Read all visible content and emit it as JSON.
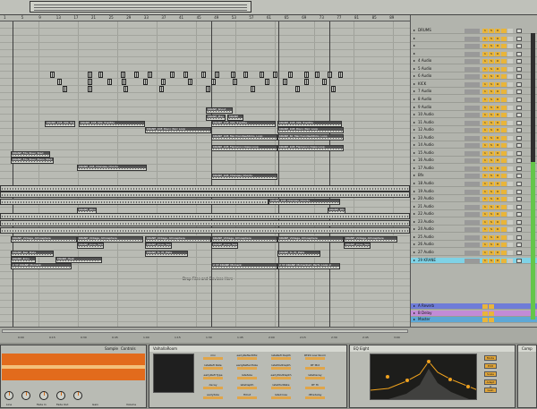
{
  "ruler": {
    "bars": [
      "1",
      "5",
      "9",
      "13",
      "17",
      "21",
      "25",
      "29",
      "33",
      "37",
      "41",
      "45",
      "49",
      "53",
      "57",
      "61",
      "65",
      "69",
      "73",
      "77",
      "81",
      "85",
      "89"
    ]
  },
  "arrangement": {
    "drop_hint": "Drop Files and Devices Here",
    "clips": [
      {
        "label": "KRANE_Shout"
      },
      {
        "label": "KRANE_Play"
      },
      {
        "label": "KRANE"
      },
      {
        "label": "KRANE_108_909_Trapfide"
      },
      {
        "label": "KRANE_108_909_Trapfide"
      },
      {
        "label": "KRANE_108_909_Trapfide"
      },
      {
        "label": "KRANE_108_909_Trapfide"
      },
      {
        "label": "KRANE_108_Disco_Perc Loop"
      },
      {
        "label": "KRANE_108_Disco_Perc Loop"
      },
      {
        "label": "KRANE_108_MarchandiseSticks_Loop"
      },
      {
        "label": "KRANE_60_MarchandiseSticks_Loop"
      },
      {
        "label": "KRANE_108_Flamenco Claps Loop"
      },
      {
        "label": "KRANE_108_Flamenco Claps Loop"
      },
      {
        "label": "KRANE_FXs_Riser_Stad"
      },
      {
        "label": "KRANE_FXs_Riser_Piano_Stad"
      },
      {
        "label": "KRANE_108_Changes_Chords"
      },
      {
        "label": "KRANE_108_Changes_Chords"
      },
      {
        "label": "KRANE_108_Changes_Chords"
      },
      {
        "label": "KRANE_Wood"
      },
      {
        "label": "KRANE_Wood"
      },
      {
        "label": "KRANE_Vintage_Atmosphere"
      },
      {
        "label": "KRANE_Vintage_Atmosphere"
      },
      {
        "label": "KRANE_Vintage_Atmosphere"
      },
      {
        "label": "KRANE_Vintage_Atmosphere"
      },
      {
        "label": "KRANE_Vintage_Atmosphere"
      },
      {
        "label": "KRANE_Vintage_Atmosphere"
      },
      {
        "label": "KRANE_Jones_Sweep"
      },
      {
        "label": "KRANE_Jones_Sweep"
      },
      {
        "label": "KRANE_Jones_Sweep"
      },
      {
        "label": "KRANE_Jones_Sweep"
      },
      {
        "label": "KRANE_Bell_Plate"
      },
      {
        "label": "KRANE_To_Pt_Plate"
      },
      {
        "label": "KRANE_To_Pt_Plate"
      },
      {
        "label": "KRANE_Echo"
      },
      {
        "label": "KRANE_Heat"
      },
      {
        "label": "2 37-KRANE_Moment"
      },
      {
        "label": "2 37-KRANE_Moment"
      },
      {
        "label": "2 37-KRANE_Momentum_Perfo_Loop_2"
      }
    ]
  },
  "tracks": [
    {
      "name": "DRUMS"
    },
    {
      "name": ""
    },
    {
      "name": ""
    },
    {
      "name": ""
    },
    {
      "name": "4 Audio"
    },
    {
      "name": "5 Audio"
    },
    {
      "name": "6 Audio"
    },
    {
      "name": "KICK"
    },
    {
      "name": "7 Audio"
    },
    {
      "name": "8 Audio"
    },
    {
      "name": "9 Audio"
    },
    {
      "name": "10 Audio"
    },
    {
      "name": "11 Audio"
    },
    {
      "name": "12 Audio"
    },
    {
      "name": "13 Audio"
    },
    {
      "name": "14 Audio"
    },
    {
      "name": "15 Audio"
    },
    {
      "name": "16 Audio"
    },
    {
      "name": "17 Audio"
    },
    {
      "name": "Bfx"
    },
    {
      "name": "18 Audio"
    },
    {
      "name": "19 Audio"
    },
    {
      "name": "20 Audio"
    },
    {
      "name": "21 Audio"
    },
    {
      "name": "22 Audio"
    },
    {
      "name": "23 Audio"
    },
    {
      "name": "24 Audio"
    },
    {
      "name": "25 Audio"
    },
    {
      "name": "26 Audio"
    },
    {
      "name": "27 Audio"
    },
    {
      "name": "29 KRANE"
    }
  ],
  "returns": [
    {
      "name": "A Reverb"
    },
    {
      "name": "B Delay"
    },
    {
      "name": "Master"
    }
  ],
  "mixer_buttons": {
    "solo": "S",
    "arm": "O",
    "track_num": "1"
  },
  "timebar": {
    "labels": [
      "0:00",
      "0:15",
      "0:30",
      "0:45",
      "1:00",
      "1:15",
      "1:30",
      "1:45",
      "2:00",
      "2:15",
      "2:30",
      "2:45",
      "3:00"
    ]
  },
  "devices": {
    "sampler": {
      "tabs": [
        "Sample",
        "Controls"
      ],
      "knobs": [
        "Line",
        "Fade In",
        "Fade Out",
        "Gain",
        "Volume"
      ]
    },
    "valhalla": {
      "title": "ValhallaRoom",
      "params": [
        "mix",
        "earlyReflectMix",
        "lateRefl Depth",
        "RTZ4 Low Room",
        "lateRefl Rate",
        "earlyReflectSize",
        "lateModDepth",
        "RT Mid",
        "earlyRefl Type",
        "lateSize",
        "earlyModDepth",
        "lateDecay",
        "decay",
        "lateDepth",
        "lateModRate",
        "RT Hi",
        "earlySize",
        "HiCut",
        "lateCross",
        "dPredelay"
      ]
    },
    "eq": {
      "title": "EQ Eight",
      "controls": [
        "Mode",
        "Edit",
        "Scale",
        "Adapt Q",
        "Gain"
      ]
    },
    "compressor": {
      "title": "Comp"
    }
  },
  "colors": {
    "selected_track": "#7fd2e6",
    "return_a": "#6f7cd8",
    "return_b": "#c28bd6",
    "master": "#5ea8d6",
    "mixer_button": "#e9b53a"
  }
}
